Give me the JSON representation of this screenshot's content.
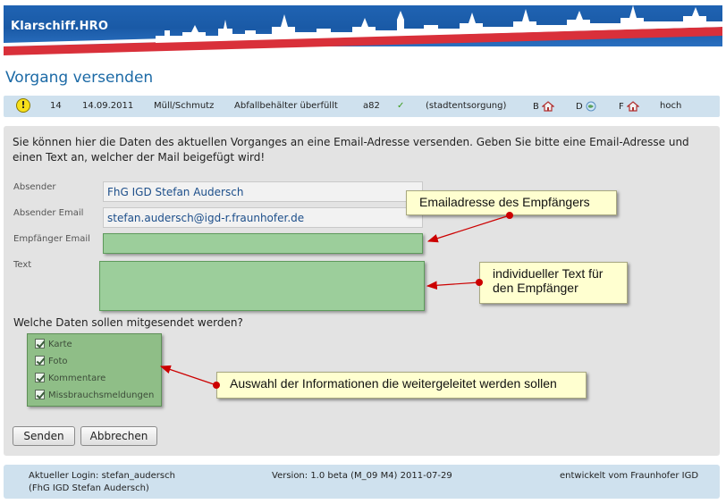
{
  "header": {
    "brand": "Klarschiff.HRO"
  },
  "page_title": "Vorgang versenden",
  "info": {
    "id": "14",
    "date": "14.09.2011",
    "category": "Müll/Schmutz",
    "subcategory": "Abfallbehälter überfüllt",
    "code": "a82",
    "department": "(stadtentsorgung)",
    "b_label": "B",
    "d_label": "D",
    "f_label": "F",
    "priority": "hoch"
  },
  "intro": "Sie können hier die Daten des aktuellen Vorganges an eine Email-Adresse versenden. Geben Sie bitte eine Email-Adresse und einen Text an, welcher der Mail beigefügt wird!",
  "form": {
    "sender_label": "Absender",
    "sender_value": "FhG IGD Stefan Audersch",
    "sender_email_label": "Absender Email",
    "sender_email_value": "stefan.audersch@igd-r.fraunhofer.de",
    "recipient_label": "Empfänger Email",
    "recipient_value": "",
    "text_label": "Text",
    "text_value": ""
  },
  "question": "Welche Daten sollen mitgesendet werden?",
  "options": [
    {
      "label": "Karte",
      "checked": true
    },
    {
      "label": "Foto",
      "checked": true
    },
    {
      "label": "Kommentare",
      "checked": true
    },
    {
      "label": "Missbrauchsmeldungen",
      "checked": true
    }
  ],
  "buttons": {
    "send": "Senden",
    "cancel": "Abbrechen"
  },
  "callouts": {
    "recipient": "Emailadresse des Empfängers",
    "text_line1": "individueller Text für",
    "text_line2": "den Empfänger",
    "options": "Auswahl der Informationen die weitergeleitet werden sollen"
  },
  "colors": {
    "accent": "#1c6aa6",
    "field_green": "#9cce9b",
    "callout_bg": "#ffffd0",
    "arrow": "#cc0000"
  },
  "footer": {
    "login_line1": "Aktueller Login: stefan_audersch",
    "login_line2": "(FhG IGD Stefan Audersch)",
    "version": "Version: 1.0 beta (M_09 M4) 2011-07-29",
    "developer": "entwickelt vom Fraunhofer IGD"
  }
}
